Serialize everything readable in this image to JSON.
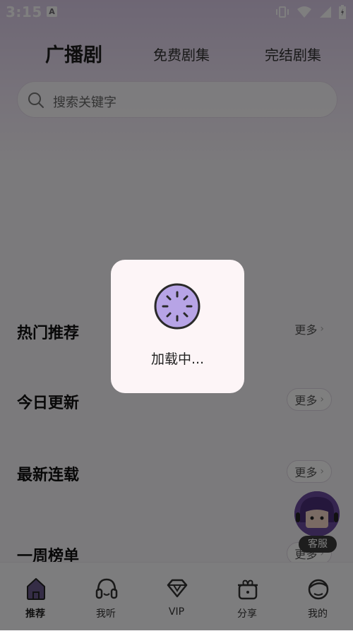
{
  "status_bar": {
    "time": "3:15",
    "app_icon_letter": "A"
  },
  "header": {
    "tabs": [
      {
        "label": "广播剧",
        "active": true
      },
      {
        "label": "免费剧集",
        "active": false
      },
      {
        "label": "完结剧集",
        "active": false
      }
    ]
  },
  "search": {
    "placeholder": "搜索关键字"
  },
  "sections": [
    {
      "title": "热门推荐",
      "more": "更多"
    },
    {
      "title": "今日更新",
      "more": "更多"
    },
    {
      "title": "最新连载",
      "more": "更多"
    },
    {
      "title": "一周榜单",
      "more": "更多"
    }
  ],
  "more_chevron": "›",
  "customer_service": {
    "label": "客服"
  },
  "loading": {
    "text": "加载中..."
  },
  "bottom_nav": [
    {
      "label": "推荐",
      "icon": "home-icon",
      "active": true
    },
    {
      "label": "我听",
      "icon": "headphones-icon",
      "active": false
    },
    {
      "label": "VIP",
      "icon": "diamond-icon",
      "active": false
    },
    {
      "label": "分享",
      "icon": "gift-icon",
      "active": false
    },
    {
      "label": "我的",
      "icon": "profile-icon",
      "active": false
    }
  ],
  "colors": {
    "accent": "#6b4aa0",
    "loading_bg": "#fdf5f7",
    "loading_icon": "#b7a4e6"
  }
}
